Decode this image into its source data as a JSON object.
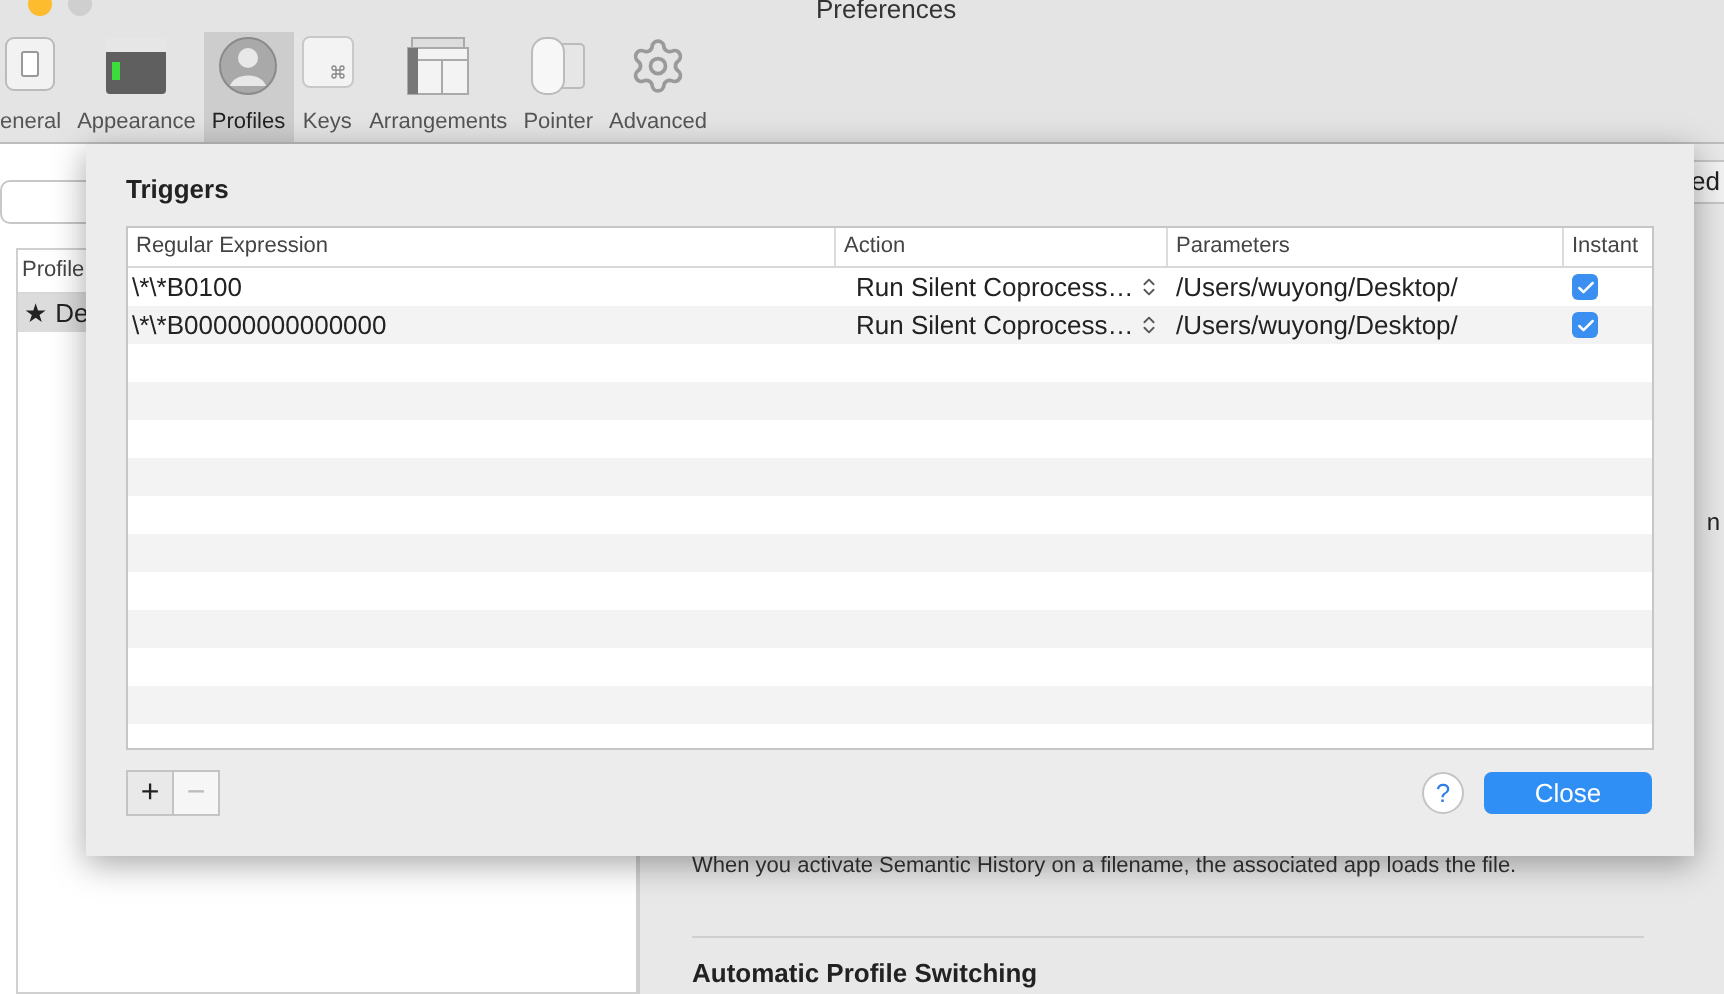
{
  "window": {
    "title": "Preferences"
  },
  "toolbar": [
    {
      "label": "eneral",
      "kind": "general",
      "selected": false
    },
    {
      "label": "Appearance",
      "kind": "appearance",
      "selected": false
    },
    {
      "label": "Profiles",
      "kind": "profiles",
      "selected": true
    },
    {
      "label": "Keys",
      "kind": "keys",
      "selected": false
    },
    {
      "label": "Arrangements",
      "kind": "arrangements",
      "selected": false
    },
    {
      "label": "Pointer",
      "kind": "pointer",
      "selected": false
    },
    {
      "label": "Advanced",
      "kind": "advanced",
      "selected": false
    }
  ],
  "profiles": {
    "column": "Profile",
    "rows": [
      {
        "label": "★ De",
        "selected": true
      }
    ]
  },
  "right_pane": {
    "fragment_1": "ed",
    "fragment_2": "n",
    "description": "When you activate Semantic History on a filename, the associated app loads the file.",
    "heading": "Automatic Profile Switching"
  },
  "sheet": {
    "title": "Triggers",
    "columns": [
      "Regular Expression",
      "Action",
      "Parameters",
      "Instant"
    ],
    "rows": [
      {
        "regex": "\\*\\*B0100",
        "action": "Run Silent Coprocess…",
        "parameters": "/Users/wuyong/Desktop/",
        "instant": true
      },
      {
        "regex": "\\*\\*B00000000000000",
        "action": "Run Silent Coprocess…",
        "parameters": "/Users/wuyong/Desktop/",
        "instant": true
      }
    ],
    "add": {
      "label": "+",
      "disabled": false
    },
    "remove": {
      "label": "−",
      "disabled": true
    },
    "help": "?",
    "close": "Close"
  }
}
